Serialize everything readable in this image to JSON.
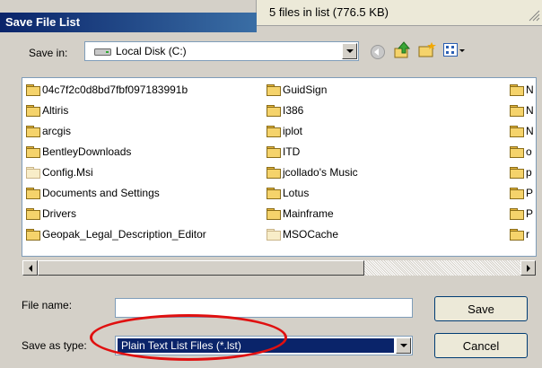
{
  "status": {
    "text": "5 files in list (776.5 KB)"
  },
  "dialog": {
    "title": "Save File List",
    "save_in_label": "Save in:",
    "save_in_value": "Local Disk (C:)",
    "items": [
      {
        "name": "04c7f2c0d8bd7fbf097183991b",
        "col": 0,
        "row": 0,
        "type": "folder"
      },
      {
        "name": "Altiris",
        "col": 0,
        "row": 1,
        "type": "folder"
      },
      {
        "name": "arcgis",
        "col": 0,
        "row": 2,
        "type": "folder"
      },
      {
        "name": "BentleyDownloads",
        "col": 0,
        "row": 3,
        "type": "folder"
      },
      {
        "name": "Config.Msi",
        "col": 0,
        "row": 4,
        "type": "folder-faded"
      },
      {
        "name": "Documents and Settings",
        "col": 0,
        "row": 5,
        "type": "folder"
      },
      {
        "name": "Drivers",
        "col": 0,
        "row": 6,
        "type": "folder"
      },
      {
        "name": "Geopak_Legal_Description_Editor",
        "col": 0,
        "row": 7,
        "type": "folder"
      },
      {
        "name": "GuidSign",
        "col": 1,
        "row": 0,
        "type": "folder"
      },
      {
        "name": "I386",
        "col": 1,
        "row": 1,
        "type": "folder"
      },
      {
        "name": "iplot",
        "col": 1,
        "row": 2,
        "type": "folder"
      },
      {
        "name": "ITD",
        "col": 1,
        "row": 3,
        "type": "folder"
      },
      {
        "name": "jcollado's Music",
        "col": 1,
        "row": 4,
        "type": "folder-music"
      },
      {
        "name": "Lotus",
        "col": 1,
        "row": 5,
        "type": "folder"
      },
      {
        "name": "Mainframe",
        "col": 1,
        "row": 6,
        "type": "folder"
      },
      {
        "name": "MSOCache",
        "col": 1,
        "row": 7,
        "type": "folder-faded"
      },
      {
        "name": "N",
        "col": 2,
        "row": 0,
        "type": "folder"
      },
      {
        "name": "N",
        "col": 2,
        "row": 1,
        "type": "folder"
      },
      {
        "name": "N",
        "col": 2,
        "row": 2,
        "type": "folder"
      },
      {
        "name": "o",
        "col": 2,
        "row": 3,
        "type": "folder"
      },
      {
        "name": "p",
        "col": 2,
        "row": 4,
        "type": "folder"
      },
      {
        "name": "P",
        "col": 2,
        "row": 5,
        "type": "folder"
      },
      {
        "name": "P",
        "col": 2,
        "row": 6,
        "type": "folder"
      },
      {
        "name": "r",
        "col": 2,
        "row": 7,
        "type": "folder"
      }
    ],
    "file_name_label": "File name:",
    "file_name_value": "",
    "save_as_type_label": "Save as type:",
    "save_as_type_value": "Plain Text List Files (*.lst)",
    "save_button": "Save",
    "cancel_button": "Cancel"
  },
  "icons": [
    "drive-icon",
    "back-icon",
    "up-folder-icon",
    "new-folder-icon",
    "view-menu-icon"
  ],
  "colors": {
    "title_bar": "#0a246a",
    "selection": "#0a246a",
    "annotation_oval": "#e01010"
  }
}
